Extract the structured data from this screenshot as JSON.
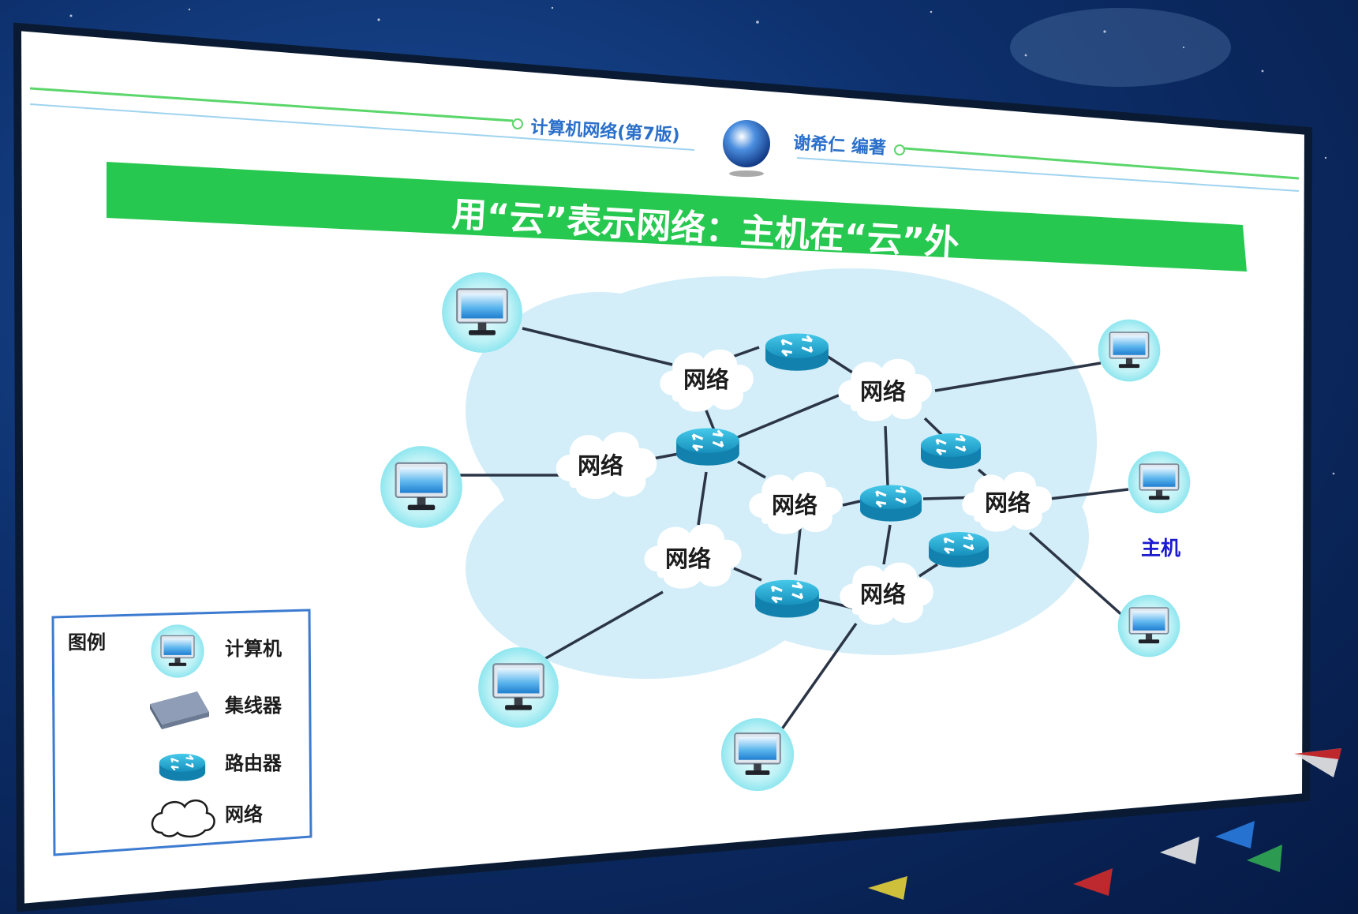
{
  "header": {
    "book_title": "计算机网络(第7版)",
    "author": "谢希仁 编著"
  },
  "banner": {
    "title": "用“云”表示网络：主机在“云”外"
  },
  "diagram": {
    "network_label": "网络",
    "host_label": "主机"
  },
  "legend": {
    "title": "图例",
    "items": [
      {
        "icon": "computer-icon",
        "label": "计算机"
      },
      {
        "icon": "hub-icon",
        "label": "集线器"
      },
      {
        "icon": "router-icon",
        "label": "路由器"
      },
      {
        "icon": "cloud-icon",
        "label": "网络"
      }
    ]
  },
  "colors": {
    "banner_green": "#27c84f",
    "cloud_fill": "#d3eef8",
    "router_teal": "#1fa9cf",
    "host_label_blue": "#1a1ad0"
  }
}
